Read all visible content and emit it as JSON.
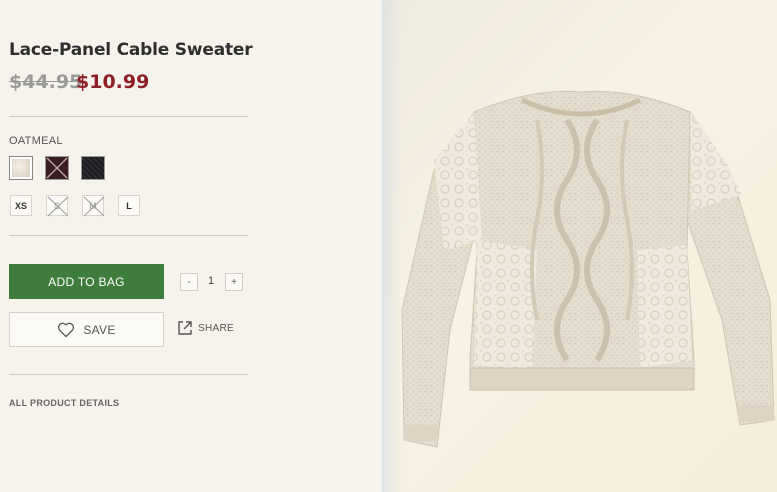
{
  "product": {
    "title": "Lace-Panel Cable Sweater",
    "original_price": "$44.95",
    "sale_price": "$10.99"
  },
  "color": {
    "selected_label": "OATMEAL",
    "swatches": [
      {
        "name": "oatmeal",
        "color": "#e9e3d6",
        "available": true,
        "selected": true
      },
      {
        "name": "burgundy",
        "color": "#3b1c22",
        "available": false,
        "selected": false
      },
      {
        "name": "black",
        "color": "#1e1e22",
        "available": true,
        "selected": false
      }
    ]
  },
  "sizes": [
    {
      "label": "XS",
      "available": true
    },
    {
      "label": "S",
      "available": false
    },
    {
      "label": "M",
      "available": false
    },
    {
      "label": "L",
      "available": true
    }
  ],
  "actions": {
    "add_to_bag": "ADD TO BAG",
    "quantity": "1",
    "decrement": "-",
    "increment": "+",
    "save": "SAVE",
    "share": "SHARE"
  },
  "links": {
    "all_details": "ALL PRODUCT DETAILS"
  },
  "colors": {
    "sale_red": "#8d1f27",
    "add_green": "#3e7d3c",
    "background": "#f6f3ec"
  },
  "icons": {
    "save": "heart-icon",
    "share": "share-icon"
  }
}
